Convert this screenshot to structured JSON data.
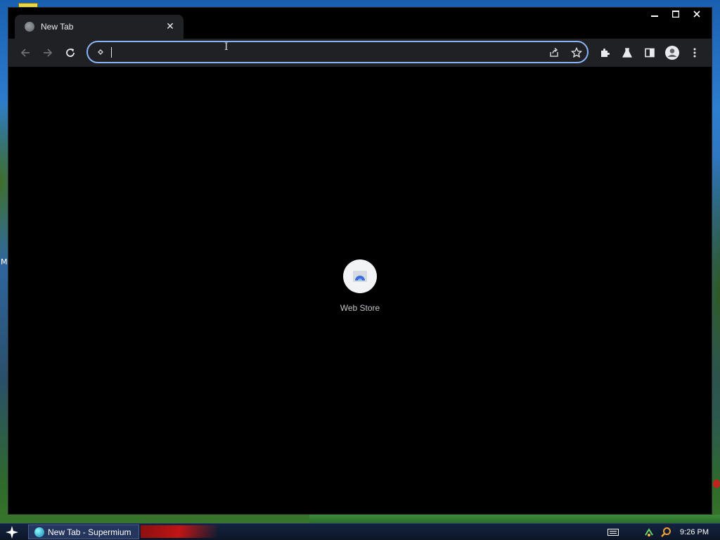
{
  "window": {
    "controls": {
      "minimize": "—",
      "maximize": "☐",
      "close": "✕"
    }
  },
  "tab": {
    "title": "New Tab",
    "close_glyph": "✕",
    "icon": "globe-icon"
  },
  "omnibox": {
    "value": "",
    "placeholder": ""
  },
  "shortcuts": [
    {
      "label": "Web Store",
      "icon": "web-store-icon"
    }
  ],
  "taskbar": {
    "task_label": "New Tab - Supermium",
    "clock": "9:26 PM"
  },
  "desktop": {
    "edge_letter": "M"
  },
  "colors": {
    "accent": "#8ab4f8",
    "toolbar_bg": "#202124",
    "content_bg": "#000000"
  }
}
